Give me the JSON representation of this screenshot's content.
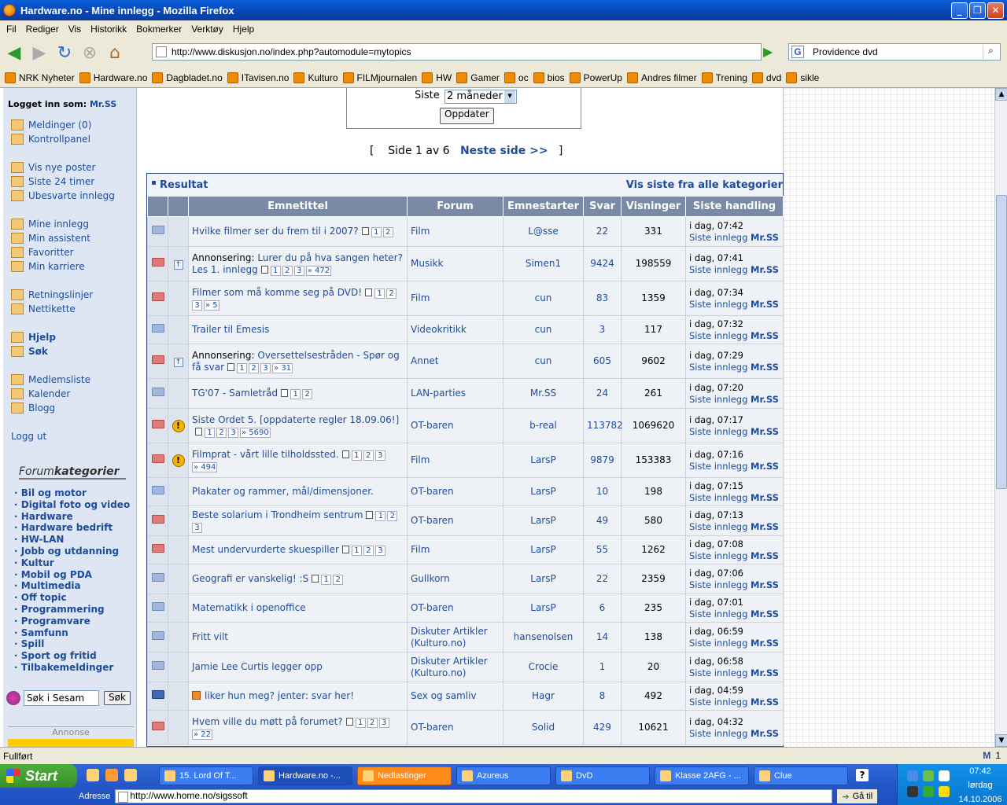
{
  "window": {
    "title": "Hardware.no - Mine innlegg - Mozilla Firefox"
  },
  "menu": [
    "Fil",
    "Rediger",
    "Vis",
    "Historikk",
    "Bokmerker",
    "Verktøy",
    "Hjelp"
  ],
  "nav": {
    "url": "http://www.diskusjon.no/index.php?automodule=mytopics",
    "search": "Providence dvd"
  },
  "bookmarks": [
    "NRK Nyheter",
    "Hardware.no",
    "Dagbladet.no",
    "ITavisen.no",
    "Kulturo",
    "FILMjournalen",
    "HW",
    "Gamer",
    "oc",
    "bios",
    "PowerUp",
    "Andres filmer",
    "Trening",
    "dvd",
    "sikle"
  ],
  "sidebar": {
    "login_label": "Logget inn som:",
    "username": "Mr.SS",
    "links": [
      "Meldinger (0)",
      "Kontrollpanel",
      "Vis nye poster",
      "Siste 24 timer",
      "Ubesvarte innlegg",
      "Mine innlegg",
      "Min assistent",
      "Favoritter",
      "Min karriere",
      "Retningslinjer",
      "Nettikette",
      "Hjelp",
      "Søk",
      "Medlemsliste",
      "Kalender",
      "Blogg",
      "Logg ut"
    ],
    "forum_label_a": "Forum",
    "forum_label_b": "kategorier",
    "categories": [
      "· Bil og motor",
      "· Digital foto og video",
      "· Hardware",
      "· Hardware bedrift",
      "· HW-LAN",
      "· Jobb og utdanning",
      "· Kultur",
      "· Mobil og PDA",
      "· Multimedia",
      "· Off topic",
      "· Programmering",
      "· Programvare",
      "· Samfunn",
      "· Spill",
      "· Sport og fritid",
      "· Tilbakemeldinger"
    ],
    "sesam_value": "Søk i Sesam",
    "sesam_button": "Søk",
    "annonse": "Annonse"
  },
  "filter": {
    "label": "Siste",
    "selected": "2 måneder",
    "button": "Oppdater"
  },
  "pager": {
    "open": "[",
    "text": "Side 1 av 6",
    "next": "Neste side >>",
    "close": "]"
  },
  "results": {
    "title": "Resultat",
    "all_link": "Vis siste fra alle kategorier",
    "headers": [
      "Emnetittel",
      "Forum",
      "Emnestarter",
      "Svar",
      "Visninger",
      "Siste handling"
    ],
    "last_prefix": "Siste innlegg",
    "last_user": "Mr.SS",
    "rows": [
      {
        "folder": "normal",
        "icon2": "",
        "prefix": "",
        "title": "Hvilke filmer ser du frem til i 2007?",
        "pages": [
          "1",
          "2"
        ],
        "forum": "Film",
        "starter": "L@sse",
        "replies": "22",
        "views": "331",
        "time": "i dag, 07:42"
      },
      {
        "folder": "hot",
        "icon2": "pin",
        "prefix": "Annonsering:",
        "title": "Lurer du på hva sangen heter? Les 1. innlegg",
        "pages": [
          "1",
          "2",
          "3",
          "» 472"
        ],
        "forum": "Musikk",
        "starter": "Simen1",
        "replies": "9424",
        "views": "198559",
        "time": "i dag, 07:41"
      },
      {
        "folder": "hot",
        "icon2": "",
        "prefix": "",
        "title": "Filmer som må komme seg på DVD!",
        "pages": [
          "1",
          "2",
          "3",
          "» 5"
        ],
        "forum": "Film",
        "starter": "cun",
        "replies": "83",
        "views": "1359",
        "time": "i dag, 07:34"
      },
      {
        "folder": "normal",
        "icon2": "",
        "prefix": "",
        "title": "Trailer til Emesis",
        "pages": [],
        "forum": "Videokritikk",
        "starter": "cun",
        "replies": "3",
        "views": "117",
        "time": "i dag, 07:32"
      },
      {
        "folder": "hot",
        "icon2": "pin",
        "prefix": "Annonsering:",
        "title": "Oversettelsestråden - Spør og få svar",
        "pages": [
          "1",
          "2",
          "3",
          "» 31"
        ],
        "forum": "Annet",
        "starter": "cun",
        "replies": "605",
        "views": "9602",
        "time": "i dag, 07:29"
      },
      {
        "folder": "normal",
        "icon2": "",
        "prefix": "",
        "title": "TG'07 - Samletråd",
        "pages": [
          "1",
          "2"
        ],
        "forum": "LAN-parties",
        "starter": "Mr.SS",
        "replies": "24",
        "views": "261",
        "time": "i dag, 07:20"
      },
      {
        "folder": "hot",
        "icon2": "warn",
        "prefix": "",
        "title": "Siste Ordet 5. [oppdaterte regler 18.09.06!]",
        "pages": [
          "1",
          "2",
          "3",
          "» 5690"
        ],
        "forum": "OT-baren",
        "starter": "b-real",
        "replies": "113782",
        "views": "1069620",
        "time": "i dag, 07:17"
      },
      {
        "folder": "hot",
        "icon2": "warn",
        "prefix": "",
        "title": "Filmprat - vårt lille tilholdssted.",
        "pages": [
          "1",
          "2",
          "3",
          "» 494"
        ],
        "forum": "Film",
        "starter": "LarsP",
        "replies": "9879",
        "views": "153383",
        "time": "i dag, 07:16"
      },
      {
        "folder": "normal",
        "icon2": "",
        "prefix": "",
        "title": "Plakater og rammer, mål/dimensjoner.",
        "pages": [],
        "forum": "OT-baren",
        "starter": "LarsP",
        "replies": "10",
        "views": "198",
        "time": "i dag, 07:15"
      },
      {
        "folder": "hot",
        "icon2": "",
        "prefix": "",
        "title": "Beste solarium i Trondheim sentrum",
        "pages": [
          "1",
          "2",
          "3"
        ],
        "forum": "OT-baren",
        "starter": "LarsP",
        "replies": "49",
        "views": "580",
        "time": "i dag, 07:13"
      },
      {
        "folder": "hot",
        "icon2": "",
        "prefix": "",
        "title": "Mest undervurderte skuespiller",
        "pages": [
          "1",
          "2",
          "3"
        ],
        "forum": "Film",
        "starter": "LarsP",
        "replies": "55",
        "views": "1262",
        "time": "i dag, 07:08"
      },
      {
        "folder": "normal",
        "icon2": "",
        "prefix": "",
        "title": "Geografi er vanskelig! :S",
        "pages": [
          "1",
          "2"
        ],
        "forum": "Gullkorn",
        "starter": "LarsP",
        "replies": "22",
        "views": "2359",
        "time": "i dag, 07:06"
      },
      {
        "folder": "normal",
        "icon2": "",
        "prefix": "",
        "title": "Matematikk i openoffice",
        "pages": [],
        "forum": "OT-baren",
        "starter": "LarsP",
        "replies": "6",
        "views": "235",
        "time": "i dag, 07:01"
      },
      {
        "folder": "normal",
        "icon2": "",
        "prefix": "",
        "title": "Fritt vilt",
        "pages": [],
        "forum": "Diskuter Artikler (Kulturo.no)",
        "starter": "hansenolsen",
        "replies": "14",
        "views": "138",
        "time": "i dag, 06:59"
      },
      {
        "folder": "normal",
        "icon2": "",
        "prefix": "",
        "title": "Jamie Lee Curtis legger opp",
        "pages": [],
        "forum": "Diskuter Artikler (Kulturo.no)",
        "starter": "Crocie",
        "replies": "1",
        "views": "20",
        "time": "i dag, 06:58"
      },
      {
        "folder": "dark",
        "icon2": "",
        "prefix": "",
        "title": "liker hun meg? jenter: svar her!",
        "pages": [],
        "forum": "Sex og samliv",
        "starter": "Hagr",
        "replies": "8",
        "views": "492",
        "time": "i dag, 04:59"
      },
      {
        "folder": "hot",
        "icon2": "",
        "prefix": "",
        "title": "Hvem ville du møtt på forumet?",
        "pages": [
          "1",
          "2",
          "3",
          "» 22"
        ],
        "forum": "OT-baren",
        "starter": "Solid",
        "replies": "429",
        "views": "10621",
        "time": "i dag, 04:32"
      }
    ]
  },
  "status": {
    "text": "Fullført",
    "right": "1"
  },
  "taskbar": {
    "start": "Start",
    "tasks": [
      "15. Lord Of T...",
      "Hardware.no -...",
      "Nedlastinger",
      "Azureus",
      "DvD",
      "Klasse 2AFG - ...",
      "Clue"
    ],
    "address_label": "Adresse",
    "address": "http://www.home.no/sigssoft",
    "go": "Gå til",
    "time": "07:42",
    "day": "lørdag",
    "date": "14.10.2006"
  }
}
